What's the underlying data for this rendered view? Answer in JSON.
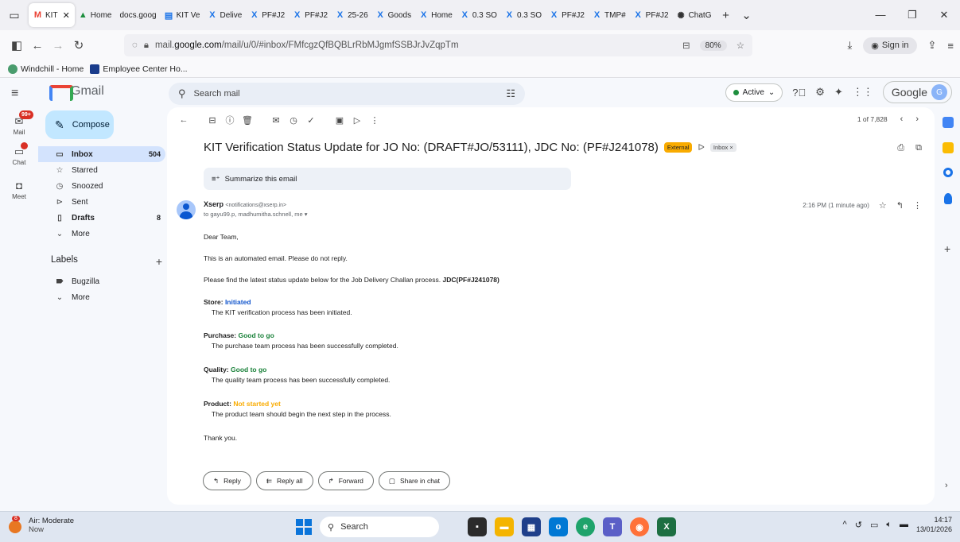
{
  "browser": {
    "tabs": [
      {
        "label": "KIT",
        "icon": "gmail-icon",
        "active": true
      },
      {
        "label": "Home",
        "icon": "drive-icon"
      },
      {
        "label": "docs.goog",
        "icon": "none"
      },
      {
        "label": "KIT Ve",
        "icon": "docs-icon"
      },
      {
        "label": "Delive",
        "icon": "x-icon"
      },
      {
        "label": "PF#J2",
        "icon": "x-icon"
      },
      {
        "label": "PF#J2",
        "icon": "x-icon"
      },
      {
        "label": "25-26",
        "icon": "x-icon"
      },
      {
        "label": "Goods",
        "icon": "x-icon"
      },
      {
        "label": "Home",
        "icon": "x-icon"
      },
      {
        "label": "0.3 SO",
        "icon": "x-icon"
      },
      {
        "label": "0.3 SO",
        "icon": "x-icon"
      },
      {
        "label": "PF#J2",
        "icon": "x-icon"
      },
      {
        "label": "TMP#",
        "icon": "x-icon"
      },
      {
        "label": "PF#J2",
        "icon": "x-icon"
      },
      {
        "label": "ChatG",
        "icon": "chatgpt-icon"
      }
    ],
    "url_prefix": "mail.",
    "url_host": "google.com",
    "url_path": "/mail/u/0/#inbox/FMfcgzQfBQBLrRbMJgmfSSBJrJvZqpTm",
    "zoom": "80%",
    "signin_label": "Sign in",
    "bookmarks": [
      "Windchill - Home",
      "Employee Center Ho..."
    ]
  },
  "gmail": {
    "logo_text": "Gmail",
    "compose_label": "Compose",
    "search_placeholder": "Search mail",
    "status": "Active",
    "account_label": "Google",
    "account_initial": "G",
    "rail": [
      {
        "label": "Mail",
        "badge": "99+"
      },
      {
        "label": "Chat",
        "badge": ""
      },
      {
        "label": "Meet",
        "badge": ""
      }
    ],
    "nav": [
      {
        "label": "Inbox",
        "count": "504",
        "icon": "inbox-icon"
      },
      {
        "label": "Starred",
        "count": "",
        "icon": "star-icon"
      },
      {
        "label": "Snoozed",
        "count": "",
        "icon": "clock-icon"
      },
      {
        "label": "Sent",
        "count": "",
        "icon": "send-icon"
      },
      {
        "label": "Drafts",
        "count": "8",
        "icon": "draft-icon"
      },
      {
        "label": "More",
        "count": "",
        "icon": "chevron-down-icon"
      }
    ],
    "labels_heading": "Labels",
    "labels": [
      {
        "label": "Bugzilla",
        "icon": "label-icon"
      },
      {
        "label": "More",
        "icon": "chevron-down-icon"
      }
    ],
    "pager": "1 of 7,828"
  },
  "email": {
    "subject": "KIT Verification Status Update for JO No: (DRAFT#JO/53111), JDC No: (PF#J241078)",
    "external_badge": "External",
    "inbox_chip": "Inbox ×",
    "summarize_label": "Summarize this email",
    "sender_name": "Xserp",
    "sender_email": "<notifications@xserp.in>",
    "to_line": "to gayu99.p, madhumitha.schnell, me",
    "time": "2:16 PM (1 minute ago)",
    "greeting": "Dear Team,",
    "line1": "This is an automated email. Please do not reply.",
    "line2_text": "Please find the latest status update below for the Job Delivery Challan process. ",
    "line2_bold": "JDC(PF#J241078)",
    "statuses": [
      {
        "label": "Store:",
        "status": "Initiated",
        "desc": "The KIT verification process has been initiated.",
        "color": "#1155cc"
      },
      {
        "label": "Purchase:",
        "status": "Good to go",
        "desc": "The purchase team process has been successfully completed.",
        "color": "#188038"
      },
      {
        "label": "Quality:",
        "status": "Good to go",
        "desc": "The quality team process has been successfully completed.",
        "color": "#188038"
      },
      {
        "label": "Product:",
        "status": "Not started yet",
        "desc": "The product team should begin the next step in the process.",
        "color": "#f9ab00"
      }
    ],
    "closing": "Thank you.",
    "actions": [
      {
        "label": "Reply",
        "icon": "reply-icon"
      },
      {
        "label": "Reply all",
        "icon": "reply-all-icon"
      },
      {
        "label": "Forward",
        "icon": "forward-icon"
      },
      {
        "label": "Share in chat",
        "icon": "share-chat-icon"
      }
    ]
  },
  "taskbar": {
    "weather_badge": "8",
    "weather_title": "Air: Moderate",
    "weather_sub": "Now",
    "search_label": "Search",
    "time": "14:17",
    "date": "13/01/2026"
  }
}
